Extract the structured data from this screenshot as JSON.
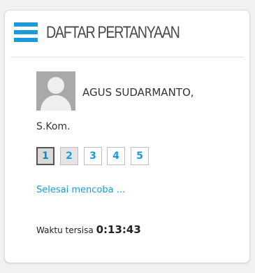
{
  "block": {
    "title": "DAFTAR PERTANYAAN",
    "menu_icon": "hamburger-menu-icon",
    "accent_color": "#1a9bd8"
  },
  "user": {
    "name_line1": "AGUS SUDARMANTO,",
    "name_line2": "S.Kom.",
    "avatar_icon": "default-user-avatar"
  },
  "questions": [
    {
      "label": "1",
      "state": "current"
    },
    {
      "label": "2",
      "state": "visited"
    },
    {
      "label": "3",
      "state": "unanswered"
    },
    {
      "label": "4",
      "state": "unanswered"
    },
    {
      "label": "5",
      "state": "unanswered"
    }
  ],
  "finish_link": "Selesai mencoba ...",
  "timer": {
    "label": "Waktu tersisa",
    "value": "0:13:43"
  }
}
